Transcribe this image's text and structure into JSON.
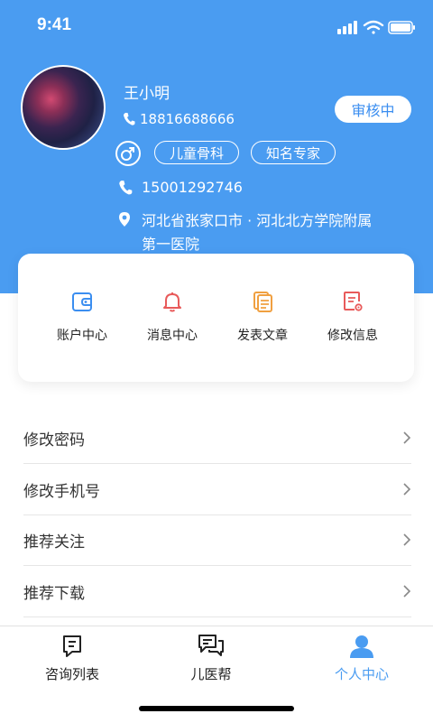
{
  "status_bar": {
    "time": "9:41"
  },
  "profile": {
    "name": "王小明",
    "phone_primary": "18816688666",
    "audit_status": "审核中",
    "tags": [
      "儿童骨科",
      "知名专家"
    ],
    "phone_secondary": "15001292746",
    "address_line1": "河北省张家口市 · 河北北方学院附属",
    "address_line2": "第一医院"
  },
  "quick_actions": [
    {
      "label": "账户中心",
      "icon": "wallet-icon",
      "color": "#3b8ef0"
    },
    {
      "label": "消息中心",
      "icon": "bell-icon",
      "color": "#e85a5a"
    },
    {
      "label": "发表文章",
      "icon": "documents-icon",
      "color": "#f0a040"
    },
    {
      "label": "修改信息",
      "icon": "edit-document-icon",
      "color": "#e85a5a"
    }
  ],
  "menu": [
    {
      "label": "修改密码"
    },
    {
      "label": "修改手机号"
    },
    {
      "label": "推荐关注"
    },
    {
      "label": "推荐下载"
    }
  ],
  "tabs": [
    {
      "label": "咨询列表",
      "icon": "consult-list-icon",
      "active": false
    },
    {
      "label": "儿医帮",
      "icon": "chat-icon",
      "active": false
    },
    {
      "label": "个人中心",
      "icon": "user-icon",
      "active": true
    }
  ],
  "colors": {
    "primary": "#4a9cf1",
    "active_tab": "#4a9cf1",
    "inactive_tab": "#222222"
  }
}
